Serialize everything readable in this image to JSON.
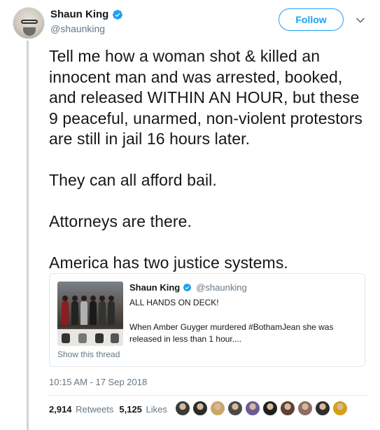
{
  "author": {
    "name": "Shaun King",
    "handle": "@shaunking",
    "verified": true
  },
  "actions": {
    "follow_label": "Follow",
    "menu_icon": "chevron-down-icon"
  },
  "tweet": {
    "text": "Tell me how a woman shot & killed an innocent man and was arrested, booked, and released WITHIN AN HOUR, but these 9 peaceful, unarmed, non-violent protestors are still in jail 16 hours later.\n\nThey can all afford bail.\n\nAttorneys are there.\n\nAmerica has two justice systems."
  },
  "quoted_tweet": {
    "name": "Shaun King",
    "handle": "@shaunking",
    "verified": true,
    "line1": "ALL HANDS ON DECK!",
    "line2": "When Amber Guyger murdered #BothamJean she was released in less than 1 hour....",
    "show_thread": "Show this thread"
  },
  "meta": {
    "timestamp": "10:15 AM - 17 Sep 2018"
  },
  "stats": {
    "retweets_count": "2,914",
    "retweets_label": "Retweets",
    "likes_count": "5,125",
    "likes_label": "Likes"
  },
  "colors": {
    "accent": "#1da1f2",
    "text": "#14171a",
    "secondary": "#657786",
    "border": "#e1e8ed"
  },
  "likers": [
    {
      "color": "#3a3a3a"
    },
    {
      "color": "#2b2b2b"
    },
    {
      "color": "#c9a66b"
    },
    {
      "color": "#4a4a4a"
    },
    {
      "color": "#6b5b95"
    },
    {
      "color": "#1f1f1f"
    },
    {
      "color": "#5d4037"
    },
    {
      "color": "#8d6e63"
    },
    {
      "color": "#2e2e2e"
    },
    {
      "color": "#d4a017"
    }
  ]
}
